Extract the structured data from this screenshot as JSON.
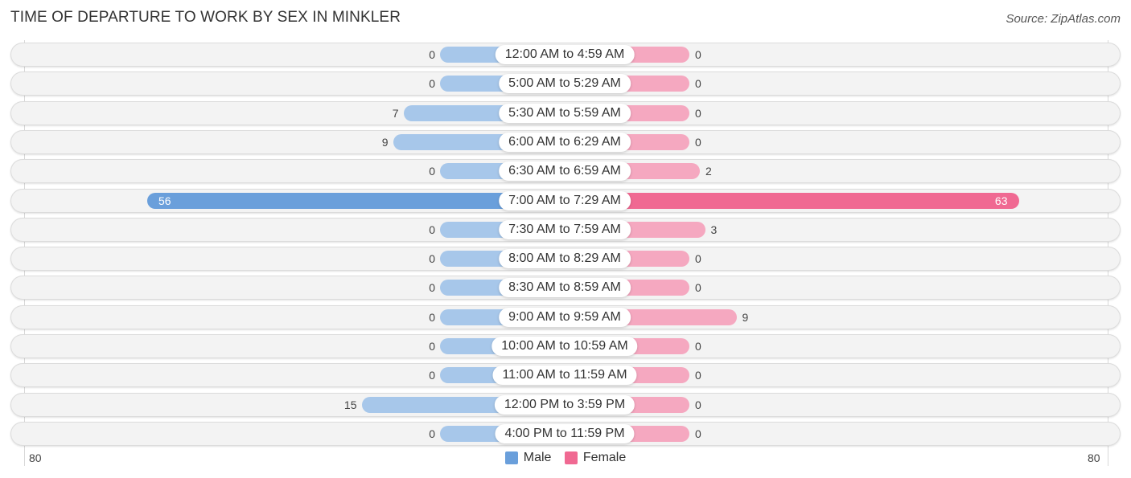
{
  "header": {
    "title": "TIME OF DEPARTURE TO WORK BY SEX IN MINKLER",
    "source": "Source: ZipAtlas.com"
  },
  "chart_data": {
    "type": "bar",
    "orientation": "horizontal-diverging",
    "title": "TIME OF DEPARTURE TO WORK BY SEX IN MINKLER",
    "categories": [
      "12:00 AM to 4:59 AM",
      "5:00 AM to 5:29 AM",
      "5:30 AM to 5:59 AM",
      "6:00 AM to 6:29 AM",
      "6:30 AM to 6:59 AM",
      "7:00 AM to 7:29 AM",
      "7:30 AM to 7:59 AM",
      "8:00 AM to 8:29 AM",
      "8:30 AM to 8:59 AM",
      "9:00 AM to 9:59 AM",
      "10:00 AM to 10:59 AM",
      "11:00 AM to 11:59 AM",
      "12:00 PM to 3:59 PM",
      "4:00 PM to 11:59 PM"
    ],
    "series": [
      {
        "name": "Male",
        "color": "#6a9fdb",
        "light_color": "#a7c7ea",
        "values": [
          0,
          0,
          7,
          9,
          0,
          56,
          0,
          0,
          0,
          0,
          0,
          0,
          15,
          0
        ]
      },
      {
        "name": "Female",
        "color": "#f06992",
        "light_color": "#f5a8c0",
        "values": [
          0,
          0,
          0,
          0,
          2,
          63,
          3,
          0,
          0,
          9,
          0,
          0,
          0,
          0
        ]
      }
    ],
    "axis": {
      "left_label": "80",
      "right_label": "80",
      "range": [
        -80,
        80
      ]
    },
    "legend": {
      "position": "bottom-center",
      "entries": [
        "Male",
        "Female"
      ]
    },
    "highlight_threshold": 40
  }
}
